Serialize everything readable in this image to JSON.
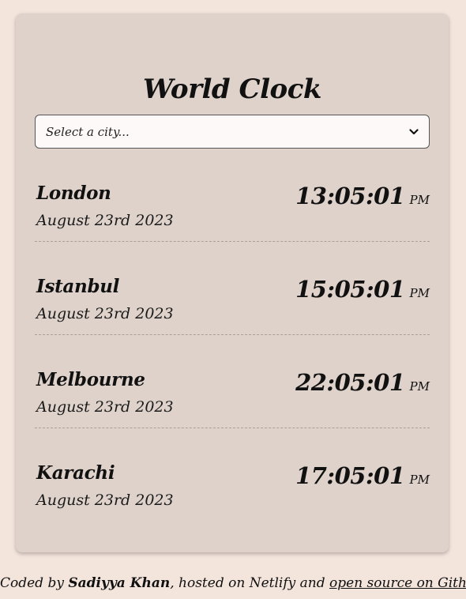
{
  "header": {
    "title": "World Clock"
  },
  "city_select": {
    "placeholder": "Select a city...",
    "icon": "chevron-down-icon"
  },
  "cities": [
    {
      "name": "London",
      "date": "August 23rd 2023",
      "time": "13:05:01",
      "ampm": "PM"
    },
    {
      "name": "Istanbul",
      "date": "August 23rd 2023",
      "time": "15:05:01",
      "ampm": "PM"
    },
    {
      "name": "Melbourne",
      "date": "August 23rd 2023",
      "time": "22:05:01",
      "ampm": "PM"
    },
    {
      "name": "Karachi",
      "date": "August 23rd 2023",
      "time": "17:05:01",
      "ampm": "PM"
    }
  ],
  "footer": {
    "prefix": "Coded by ",
    "author": "Sadiyya Khan",
    "middle": ", hosted on Netlify and ",
    "link_text": "open source on Github"
  },
  "colors": {
    "page_background": "#f3e4dc",
    "card_background": "#ded2ca",
    "select_background": "#fdf9f8"
  }
}
